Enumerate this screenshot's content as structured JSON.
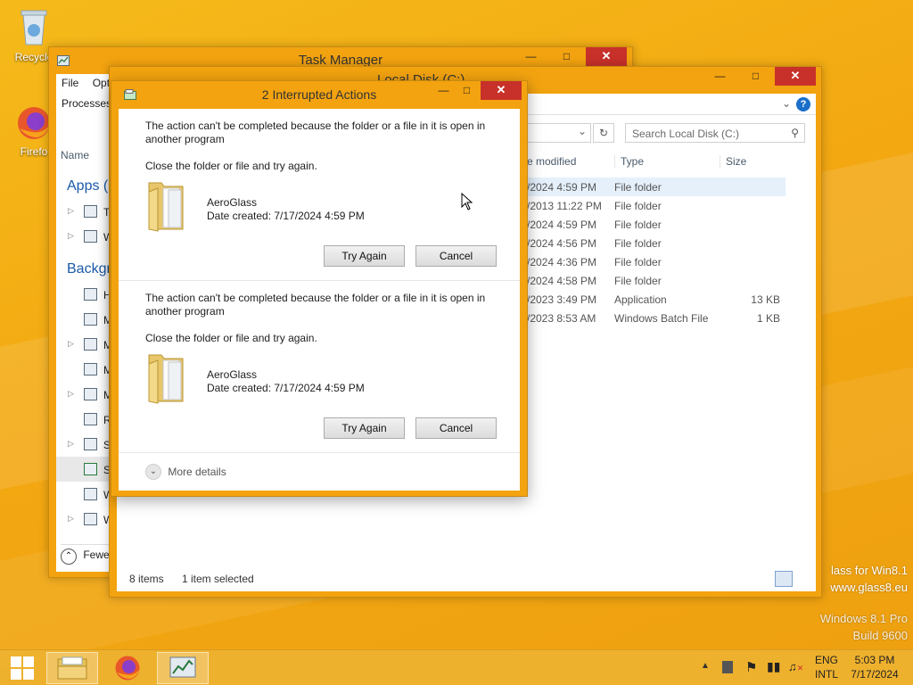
{
  "desktop": {
    "icons": [
      {
        "label": "Recycle"
      },
      {
        "label": "Firefo"
      }
    ],
    "watermark": {
      "line1": "lass for Win8.1",
      "line2": "www.glass8.eu",
      "line3": "Windows 8.1 Pro",
      "line4": "Build 9600"
    }
  },
  "task_manager": {
    "title": "Task Manager",
    "menu": [
      "File",
      "Optio"
    ],
    "tab": "Processes",
    "column_name": "Name",
    "group_apps": "Apps (2",
    "group_background": "Backgro",
    "rows": [
      "Ta",
      "W",
      "He",
      "M",
      "M",
      "M",
      "M",
      "Ru",
      "Sp",
      "St",
      "W",
      "W"
    ],
    "fewer_details": "Fewe"
  },
  "explorer": {
    "title": "Local Disk (C:)",
    "search_placeholder": "Search Local Disk (C:)",
    "columns": {
      "date": "e modified",
      "type": "Type",
      "size": "Size"
    },
    "rows": [
      {
        "date": "/2024 4:59 PM",
        "type": "File folder",
        "size": ""
      },
      {
        "date": "/2013 11:22 PM",
        "type": "File folder",
        "size": ""
      },
      {
        "date": "/2024 4:59 PM",
        "type": "File folder",
        "size": ""
      },
      {
        "date": "/2024 4:56 PM",
        "type": "File folder",
        "size": ""
      },
      {
        "date": "/2024 4:36 PM",
        "type": "File folder",
        "size": ""
      },
      {
        "date": "/2024 4:58 PM",
        "type": "File folder",
        "size": ""
      },
      {
        "date": "/2023 3:49 PM",
        "type": "Application",
        "size": "13 KB"
      },
      {
        "date": "/2023 8:53 AM",
        "type": "Windows Batch File",
        "size": "1 KB"
      }
    ],
    "status_items": "8 items",
    "status_selected": "1 item selected"
  },
  "dialog": {
    "title": "2 Interrupted Actions",
    "actions": [
      {
        "message": "The action can't be completed because the folder or a file in it is open in another program",
        "instruction": "Close the folder or file and try again.",
        "item_name": "AeroGlass",
        "item_date": "Date created: 7/17/2024 4:59 PM",
        "try_again": "Try Again",
        "cancel": "Cancel"
      },
      {
        "message": "The action can't be completed because the folder or a file in it is open in another program",
        "instruction": "Close the folder or file and try again.",
        "item_name": "AeroGlass",
        "item_date": "Date created: 7/17/2024 4:59 PM",
        "try_again": "Try Again",
        "cancel": "Cancel"
      }
    ],
    "more_details": "More details"
  },
  "taskbar": {
    "lang1": "ENG",
    "lang2": "INTL",
    "time": "5:03 PM",
    "date": "7/17/2024"
  },
  "colors": {
    "accent": "#f3a30f",
    "close": "#c7312a",
    "link": "#1a5aa8"
  }
}
